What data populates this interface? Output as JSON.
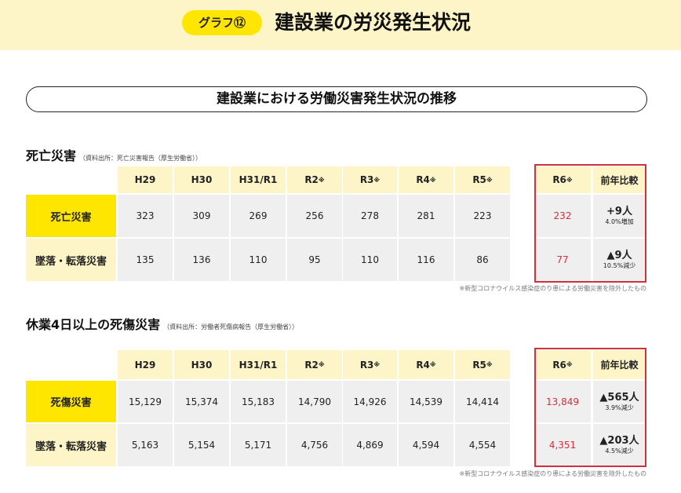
{
  "header": {
    "badge": "グラフ⑫",
    "title": "建設業の労災発生状況"
  },
  "subtitle": "建設業における労働災害発生状況の推移",
  "section1": {
    "title": "死亡災害",
    "source": "（資料出所：死亡災害報告（厚生労働省））",
    "year_headers": [
      "H29",
      "H30",
      "H31/R1",
      "R2",
      "R3",
      "R4",
      "R5"
    ],
    "r6_header": "R6",
    "compare_header": "前年比較",
    "asterisk": "※",
    "rows": [
      {
        "label": "死亡災害",
        "values": [
          "323",
          "309",
          "269",
          "256",
          "278",
          "281",
          "223"
        ],
        "r6": "232",
        "change": "+9人",
        "change_sub": "4.0%増加"
      },
      {
        "label": "墜落・転落災害",
        "values": [
          "135",
          "136",
          "110",
          "95",
          "110",
          "116",
          "86"
        ],
        "r6": "77",
        "change": "▲9人",
        "change_sub": "10.5%減少"
      }
    ],
    "note": "※新型コロナウイルス感染症のり患による労働災害を除外したもの"
  },
  "section2": {
    "title": "休業4日以上の死傷災害",
    "source": "（資料出所：労働者死傷病報告（厚生労働省））",
    "year_headers": [
      "H29",
      "H30",
      "H31/R1",
      "R2",
      "R3",
      "R4",
      "R5"
    ],
    "r6_header": "R6",
    "compare_header": "前年比較",
    "asterisk": "※",
    "rows": [
      {
        "label": "死傷災害",
        "values": [
          "15,129",
          "15,374",
          "15,183",
          "14,790",
          "14,926",
          "14,539",
          "14,414"
        ],
        "r6": "13,849",
        "change": "▲565人",
        "change_sub": "3.9%減少"
      },
      {
        "label": "墜落・転落災害",
        "values": [
          "5,163",
          "5,154",
          "5,171",
          "4,756",
          "4,869",
          "4,594",
          "4,554"
        ],
        "r6": "4,351",
        "change": "▲203人",
        "change_sub": "4.5%減少"
      }
    ],
    "note": "※新型コロナウイルス感染症のり患による労働災害を除外したもの"
  },
  "colors": {
    "yellow": "#ffe600",
    "pale_yellow": "#fdf5c7",
    "gray": "#efefef",
    "red": "#d0313c"
  }
}
